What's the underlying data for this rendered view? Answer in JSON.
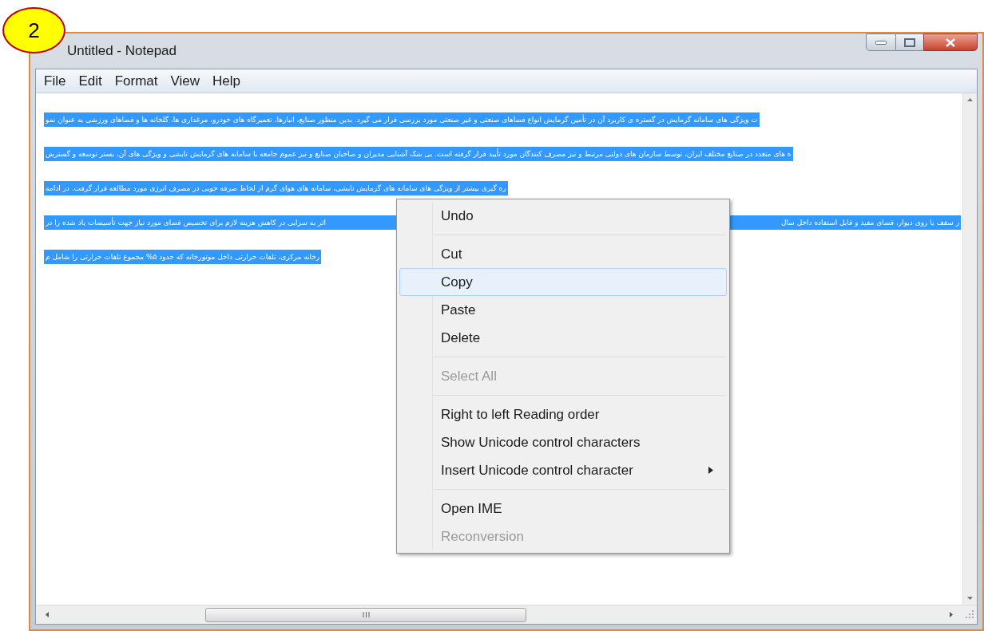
{
  "badge": "2",
  "window": {
    "title": "Untitled - Notepad"
  },
  "menu_bar": [
    {
      "label": "File"
    },
    {
      "label": "Edit"
    },
    {
      "label": "Format"
    },
    {
      "label": "View"
    },
    {
      "label": "Help"
    }
  ],
  "editor": {
    "lines": [
      {
        "segments": [
          "ت ویژگی های سامانه گرمایش در گستره ی کاربرد آن در تأمین گرمایش انواع فضاهای صنعتی و غیر صنعتی مورد بررسی قرار می گیرد. بدین منظور صنایع، انبارها، تعمیرگاه های خودرو، مرغداری ها، گلخانه ها و فضاهای ورزشی به عنوان نمو"
        ],
        "selected": true
      },
      {
        "segments": [
          "ه های متعدد در صنایع مختلف ایران، توسط سازمان های دولتی مرتبط و نیز مصرف کنندگان مورد تأیید قرار گرفته است. بی شک آشنایی مدیران و صاحبان صنایع و نیز عموم جامعه با سامانه های گرمایش تابشی و ویژگی های آن، بستر توسعه و گسترش"
        ],
        "selected": true
      },
      {
        "segments": [
          "ره گیری بیشتر از ویژگی های سامانه های گرمایش تابشی، سامانه های هوای گرم از لحاظ صرفه جویی در مصرف انرژی مورد مطالعه قرار گرفت. در ادامه"
        ],
        "selected": true
      },
      {
        "segments": [
          "ر سقف یا روی دیوار، فضای مفید و قابل استفاده داخل سال",
          "اثر به سزایی در کاهش هزینه لازم برای تخصیص فضای مورد نیاز جهت تأسیسات یاد شده را در"
        ],
        "selected": true
      },
      {
        "segments": [
          "رخانه مرکزی، تلفات حرارتی داخل موتورخانه که حدود ۵% مجموع تلفات حرارتی را شامل م"
        ],
        "selected": true
      }
    ]
  },
  "context_menu": [
    {
      "kind": "item",
      "label": "Undo",
      "disabled": false,
      "selected": false,
      "submenu": false
    },
    {
      "kind": "separator"
    },
    {
      "kind": "item",
      "label": "Cut",
      "disabled": false,
      "selected": false,
      "submenu": false
    },
    {
      "kind": "item",
      "label": "Copy",
      "disabled": false,
      "selected": true,
      "submenu": false
    },
    {
      "kind": "item",
      "label": "Paste",
      "disabled": false,
      "selected": false,
      "submenu": false
    },
    {
      "kind": "item",
      "label": "Delete",
      "disabled": false,
      "selected": false,
      "submenu": false
    },
    {
      "kind": "separator"
    },
    {
      "kind": "item",
      "label": "Select All",
      "disabled": true,
      "selected": false,
      "submenu": false
    },
    {
      "kind": "separator"
    },
    {
      "kind": "item",
      "label": "Right to left Reading order",
      "disabled": false,
      "selected": false,
      "submenu": false
    },
    {
      "kind": "item",
      "label": "Show Unicode control characters",
      "disabled": false,
      "selected": false,
      "submenu": false
    },
    {
      "kind": "item",
      "label": "Insert Unicode control character",
      "disabled": false,
      "selected": false,
      "submenu": true
    },
    {
      "kind": "separator"
    },
    {
      "kind": "item",
      "label": "Open IME",
      "disabled": false,
      "selected": false,
      "submenu": false
    },
    {
      "kind": "item",
      "label": "Reconversion",
      "disabled": true,
      "selected": false,
      "submenu": false
    }
  ]
}
